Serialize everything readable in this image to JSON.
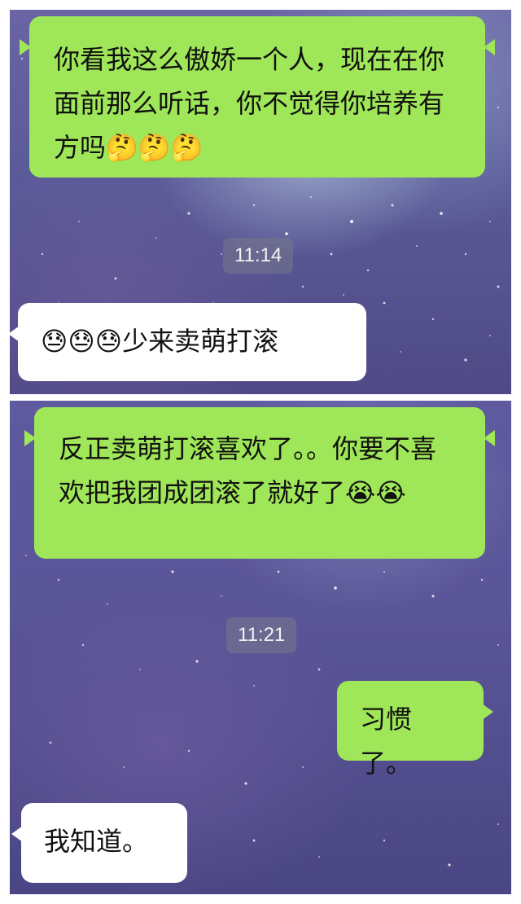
{
  "conversation_top": {
    "message_1": {
      "text": "你看我这么傲娇一个人，现在在你面前那么听话，你不觉得你培养有方吗🤔🤔🤔"
    },
    "timestamp": "11:14",
    "message_2": {
      "text": "😓😓😓少来卖萌打滚"
    }
  },
  "conversation_bottom": {
    "message_1": {
      "text": "反正卖萌打滚喜欢了。。你要不喜欢把我团成团滚了就好了😭😭"
    },
    "timestamp": "11:21",
    "message_2": {
      "text": "习惯了。"
    },
    "message_3": {
      "text": "我知道。"
    }
  },
  "colors": {
    "sent_bubble": "#9fe658",
    "received_bubble": "#ffffff",
    "timestamp_bg": "rgba(120,120,140,0.55)"
  }
}
